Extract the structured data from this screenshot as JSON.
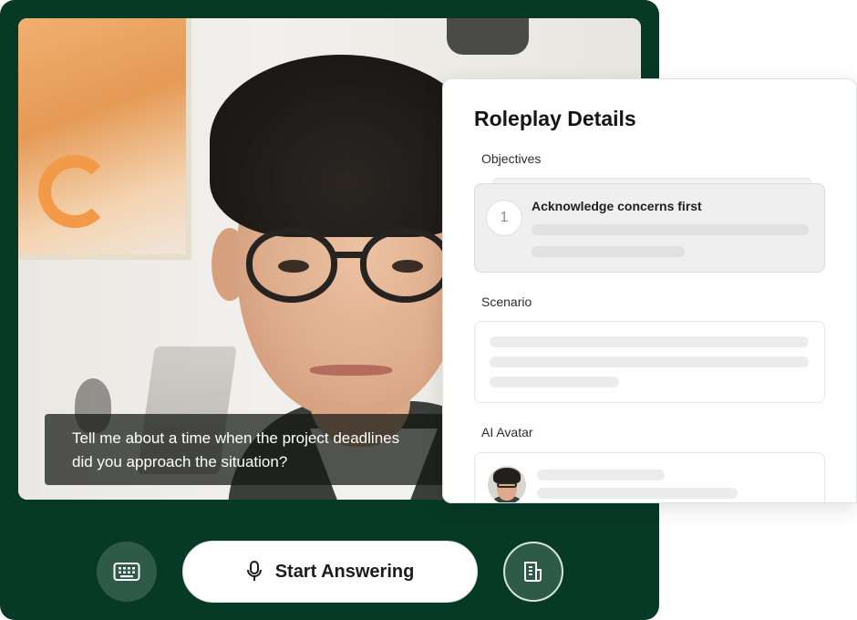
{
  "video": {
    "caption_lines": [
      "Tell me about a time when the project deadlines",
      "did you approach the situation?"
    ]
  },
  "controls": {
    "start_label": "Start Answering",
    "icons": {
      "keyboard": "keyboard-icon",
      "mic": "microphone-icon",
      "document": "document-icon"
    }
  },
  "panel": {
    "title": "Roleplay Details",
    "objectives": {
      "label": "Objectives",
      "items": [
        {
          "number": "1",
          "title": "Acknowledge concerns first"
        }
      ]
    },
    "scenario": {
      "label": "Scenario"
    },
    "avatar": {
      "label": "AI Avatar"
    }
  },
  "colors": {
    "stage": "#063a26",
    "button_dark": "#2e5b48",
    "panel_border": "#d9e7e0"
  }
}
